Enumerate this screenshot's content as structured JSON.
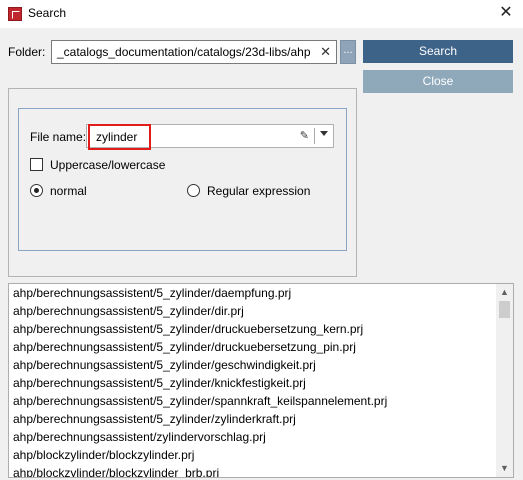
{
  "window": {
    "title": "Search"
  },
  "folder": {
    "label": "Folder:",
    "value": "_catalogs_documentation/catalogs/23d-libs/ahp",
    "browse_label": "..."
  },
  "buttons": {
    "search": "Search",
    "close": "Close"
  },
  "file_name": {
    "label": "File name:",
    "value": "zylinder"
  },
  "options": {
    "case_label": "Uppercase/lowercase",
    "case_checked": false,
    "mode_normal": "normal",
    "mode_regex": "Regular expression",
    "selected_mode": "normal"
  },
  "results": [
    "ahp/berechnungsassistent/5_zylinder/daempfung.prj",
    "ahp/berechnungsassistent/5_zylinder/dir.prj",
    "ahp/berechnungsassistent/5_zylinder/druckuebersetzung_kern.prj",
    "ahp/berechnungsassistent/5_zylinder/druckuebersetzung_pin.prj",
    "ahp/berechnungsassistent/5_zylinder/geschwindigkeit.prj",
    "ahp/berechnungsassistent/5_zylinder/knickfestigkeit.prj",
    "ahp/berechnungsassistent/5_zylinder/spannkraft_keilspannelement.prj",
    "ahp/berechnungsassistent/5_zylinder/zylinderkraft.prj",
    "ahp/berechnungsassistent/zylindervorschlag.prj",
    "ahp/blockzylinder/blockzylinder.prj",
    "ahp/blockzylinder/blockzylinder_brb.prj"
  ],
  "colors": {
    "search_button": "#3d6389",
    "close_button": "#8fa9bb",
    "highlight": "#e21b1b"
  }
}
